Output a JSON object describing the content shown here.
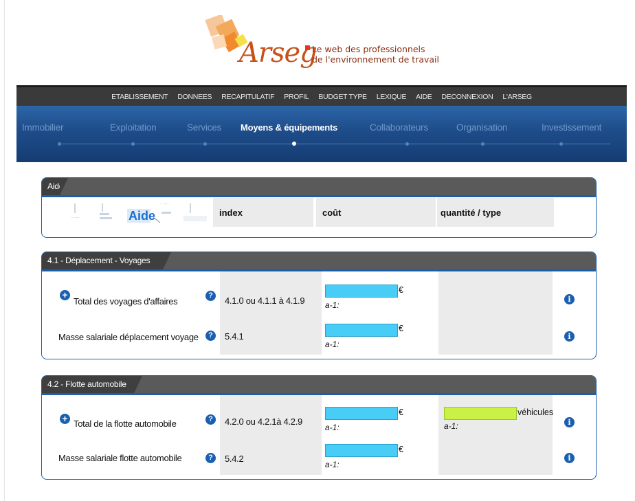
{
  "logo": {
    "word": "Arseg",
    "tagline_line1": "Le web des professionnels",
    "tagline_line2": "de l'environnement de travail",
    "colors": {
      "accent": "#c8511b",
      "tile": "#f2a95a"
    }
  },
  "top_nav": [
    "ETABLISSEMENT",
    "DONNEES",
    "RECAPITULATIF",
    "PROFIL",
    "BUDGET TYPE",
    "LEXIQUE",
    "AIDE",
    "DECONNEXION",
    "L'ARSEG"
  ],
  "main_nav": {
    "items": [
      "Immobilier",
      "Exploitation",
      "Services",
      "Moyens & équipements",
      "Collaborateurs",
      "Organisation",
      "Investissement"
    ],
    "active_index": 3
  },
  "aide_panel": {
    "title": "Aide",
    "thumb_label": "Aide",
    "headers": {
      "index": "index",
      "cost": "coût",
      "quantity": "quantité / type"
    }
  },
  "section_41": {
    "title": "4.1 - Déplacement - Voyages",
    "rows": [
      {
        "label": "Total des voyages d'affaires",
        "index": "4.1.0 ou 4.1.1 à 4.1.9",
        "unit": "€",
        "prev": "a-1:",
        "expandable": true
      },
      {
        "label": "Masse salariale déplacement voyage",
        "index": "5.4.1",
        "unit": "€",
        "prev": "a-1:",
        "expandable": false
      }
    ]
  },
  "section_42": {
    "title": "4.2 - Flotte automobile",
    "rows": [
      {
        "label": "Total de la flotte automobile",
        "index": "4.2.0 ou 4.2.1à 4.2.9",
        "unit": "€",
        "prev": "a-1:",
        "qty_unit": "véhicules",
        "qty_prev": "a-1:",
        "expandable": true
      },
      {
        "label": "Masse salariale flotte automobile",
        "index": "5.4.2",
        "unit": "€",
        "prev": "a-1:",
        "expandable": false
      }
    ]
  },
  "icons": {
    "plus": "plus-circle-icon",
    "help": "question-circle-icon",
    "info": "info-circle-icon"
  },
  "colors": {
    "nav_blue": "#1f4e8c",
    "input_cyan": "#47cdf6",
    "input_lime": "#c9f244",
    "panel_border": "#1d5ea8"
  }
}
